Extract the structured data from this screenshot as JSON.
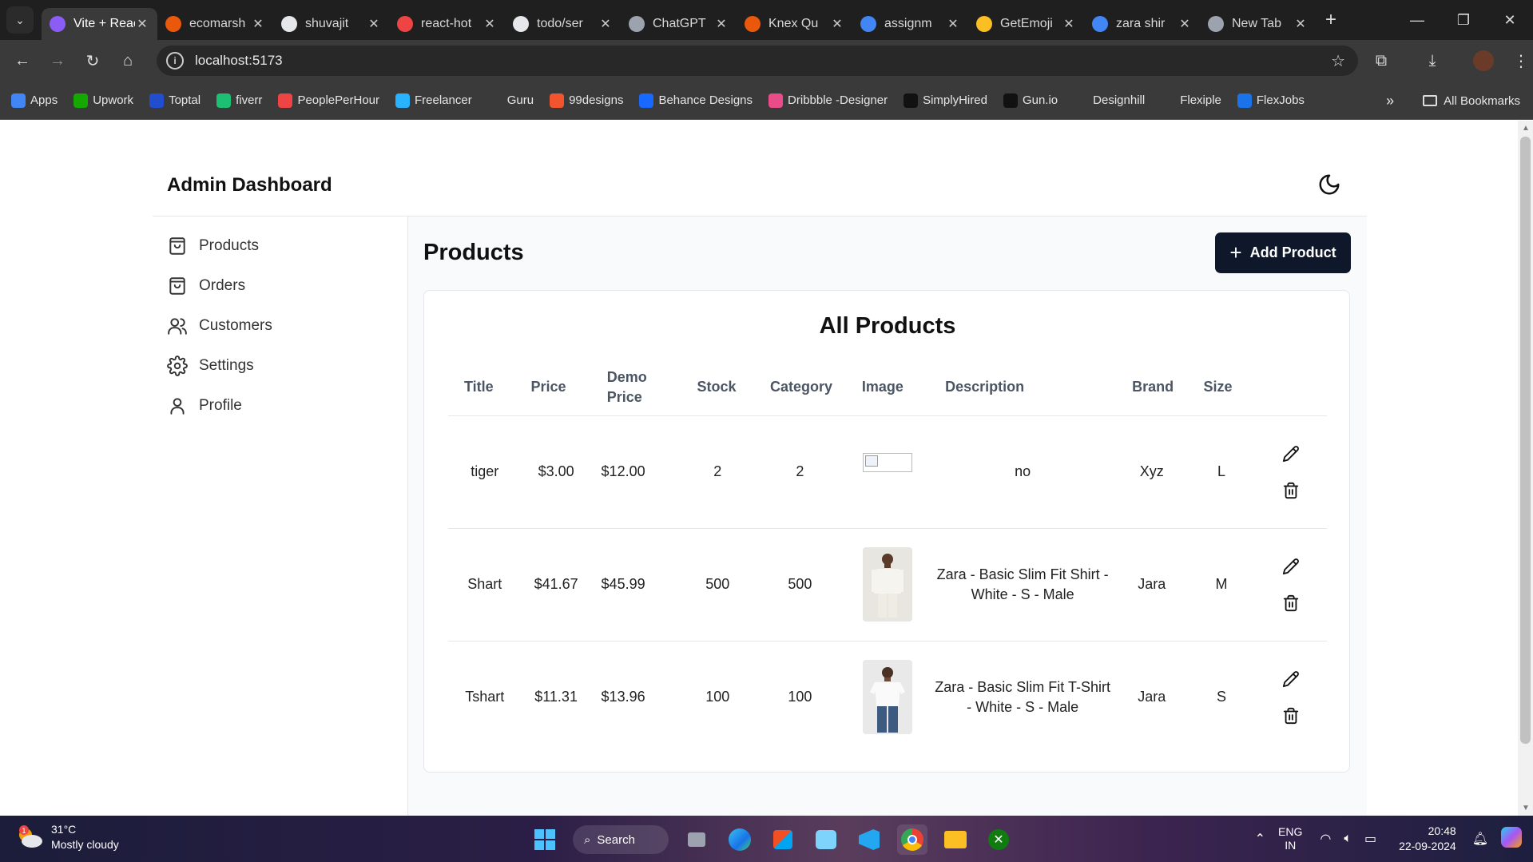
{
  "browser": {
    "tabs": [
      {
        "label": "Vite + React + TS",
        "favicon_color": "#8b5cf6",
        "active": true
      },
      {
        "label": "ecomarsh",
        "favicon_color": "#ea580c",
        "active": false
      },
      {
        "label": "shuvajit",
        "favicon_color": "#e5e7eb",
        "active": false
      },
      {
        "label": "react-hot",
        "favicon_color": "#ef4444",
        "active": false
      },
      {
        "label": "todo/ser",
        "favicon_color": "#e5e7eb",
        "active": false
      },
      {
        "label": "ChatGPT",
        "favicon_color": "#9ca3af",
        "active": false
      },
      {
        "label": "Knex Qu",
        "favicon_color": "#ea580c",
        "active": false
      },
      {
        "label": "assignm",
        "favicon_color": "#4285f4",
        "active": false
      },
      {
        "label": "GetEmoji",
        "favicon_color": "#fbbf24",
        "active": false
      },
      {
        "label": "zara shir",
        "favicon_color": "#4285f4",
        "active": false
      },
      {
        "label": "New Tab",
        "favicon_color": "#9ca3af",
        "active": false
      }
    ],
    "url": "localhost:5173",
    "bookmarks": [
      {
        "label": "Apps",
        "color": "#4285f4"
      },
      {
        "label": "Upwork",
        "color": "#14a800"
      },
      {
        "label": "Toptal",
        "color": "#204ecf"
      },
      {
        "label": "fiverr",
        "color": "#1dbf73"
      },
      {
        "label": "PeoplePerHour",
        "color": "#ef4444"
      },
      {
        "label": "Freelancer",
        "color": "#29b2fe"
      },
      {
        "label": "Guru",
        "color": "#3a3a3a"
      },
      {
        "label": "99designs",
        "color": "#f2542d"
      },
      {
        "label": "Behance Designs",
        "color": "#1769ff"
      },
      {
        "label": "Dribbble -Designer",
        "color": "#ea4c89"
      },
      {
        "label": "SimplyHired",
        "color": "#111111"
      },
      {
        "label": "Gun.io",
        "color": "#111111"
      },
      {
        "label": "Designhill",
        "color": "#3a3a3a"
      },
      {
        "label": "Flexiple",
        "color": "#3a3a3a"
      },
      {
        "label": "FlexJobs",
        "color": "#1a73e8"
      }
    ],
    "bookmarks_more": "»",
    "all_bookmarks": "All Bookmarks"
  },
  "app": {
    "title": "Admin Dashboard",
    "sidebar": [
      {
        "label": "Products",
        "icon": "shopping-bag-icon"
      },
      {
        "label": "Orders",
        "icon": "shopping-bag-icon"
      },
      {
        "label": "Customers",
        "icon": "users-icon"
      },
      {
        "label": "Settings",
        "icon": "gear-icon"
      },
      {
        "label": "Profile",
        "icon": "user-icon"
      }
    ],
    "page_title": "Products",
    "add_button": "Add Product",
    "card_title": "All Products",
    "columns": [
      "Title",
      "Price",
      "Demo Price",
      "Stock",
      "Category",
      "Image",
      "Description",
      "Brand",
      "Size"
    ],
    "products": [
      {
        "title": "tiger",
        "price": "$3.00",
        "demo_price": "$12.00",
        "stock": "2",
        "category": "2",
        "image": "broken",
        "description": "no",
        "brand": "Xyz",
        "size": "L"
      },
      {
        "title": "Shart",
        "price": "$41.67",
        "demo_price": "$45.99",
        "stock": "500",
        "category": "500",
        "image": "shirt",
        "description": "Zara - Basic Slim Fit Shirt - White - S - Male",
        "brand": "Jara",
        "size": "M"
      },
      {
        "title": "Tshart",
        "price": "$11.31",
        "demo_price": "$13.96",
        "stock": "100",
        "category": "100",
        "image": "tshirt",
        "description": "Zara - Basic Slim Fit T-Shirt - White - S - Male",
        "brand": "Jara",
        "size": "S"
      }
    ]
  },
  "taskbar": {
    "weather_temp": "31°C",
    "weather_desc": "Mostly cloudy",
    "weather_badge": "1",
    "search": "Search",
    "lang_1": "ENG",
    "lang_2": "IN",
    "time": "20:48",
    "date": "22-09-2024"
  },
  "colors": {
    "primary_button": "#0f172a",
    "main_background": "#f9fafb",
    "border": "#e5e7eb"
  }
}
